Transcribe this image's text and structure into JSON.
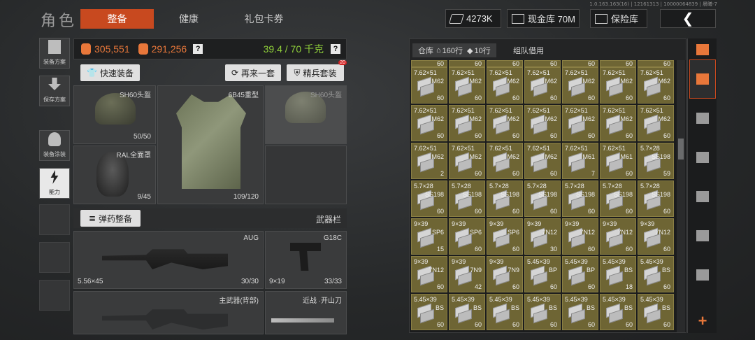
{
  "header": {
    "title": "角色",
    "tabs": [
      {
        "label": "整备",
        "active": true
      },
      {
        "label": "健康",
        "active": false
      },
      {
        "label": "礼包卡券",
        "active": false
      }
    ],
    "version": "1.0.163.163(16) | 12161313 | 10000064839 | 晨曦-7",
    "currency": "4273K",
    "cash_vault": "现金库 70M",
    "safe": "保险库"
  },
  "sidebar": [
    {
      "label": "装备方案"
    },
    {
      "label": "保存方案"
    },
    {
      "label": "装备涂装"
    },
    {
      "label": "能力"
    }
  ],
  "stats": {
    "value1": "305,551",
    "value2": "291,256",
    "weight": "39.4 / 70 千克"
  },
  "actions": {
    "quick_equip": "快速装备",
    "again": "再来一套",
    "elite": "精兵套装",
    "elite_badge": "20"
  },
  "gear": {
    "helmet": {
      "name": "SH60头盔",
      "durability": "50/50"
    },
    "armor": {
      "name": "6B45重型",
      "durability": "109/120"
    },
    "helmet_preview": {
      "name": "SH60头盔"
    },
    "mask": {
      "name": "RAL全面罩",
      "durability": "9/45"
    }
  },
  "weapons": {
    "ammo_button": "弹药整备",
    "section": "武器栏",
    "primary": {
      "name": "AUG",
      "caliber": "5.56×45",
      "ammo": "30/30"
    },
    "pistol": {
      "name": "G18C",
      "caliber": "9×19",
      "ammo": "33/33"
    },
    "backup": {
      "name": "主武器(背部)"
    },
    "melee": {
      "name": "开山刀",
      "prefix": "近战 ·"
    }
  },
  "inventory": {
    "tab_label": "仓库",
    "rows_label": "160行",
    "rows_label2": "10行",
    "tab2": "组队借用",
    "rows": [
      [
        {
          "cal": "",
          "mod": "",
          "qty": "60"
        },
        {
          "cal": "",
          "mod": "",
          "qty": "60"
        },
        {
          "cal": "",
          "mod": "",
          "qty": "60"
        },
        {
          "cal": "",
          "mod": "",
          "qty": "60"
        },
        {
          "cal": "",
          "mod": "",
          "qty": "60"
        },
        {
          "cal": "",
          "mod": "",
          "qty": "60"
        },
        {
          "cal": "",
          "mod": "",
          "qty": "60"
        }
      ],
      [
        {
          "cal": "7.62×51",
          "mod": "M62",
          "qty": "60"
        },
        {
          "cal": "7.62×51",
          "mod": "M62",
          "qty": "60"
        },
        {
          "cal": "7.62×51",
          "mod": "M62",
          "qty": "60"
        },
        {
          "cal": "7.62×51",
          "mod": "M62",
          "qty": "60"
        },
        {
          "cal": "7.62×51",
          "mod": "M62",
          "qty": "60"
        },
        {
          "cal": "7.62×51",
          "mod": "M62",
          "qty": "60"
        },
        {
          "cal": "7.62×51",
          "mod": "M62",
          "qty": "60"
        }
      ],
      [
        {
          "cal": "7.62×51",
          "mod": "M62",
          "qty": "60"
        },
        {
          "cal": "7.62×51",
          "mod": "M62",
          "qty": "60"
        },
        {
          "cal": "7.62×51",
          "mod": "M62",
          "qty": "60"
        },
        {
          "cal": "7.62×51",
          "mod": "M62",
          "qty": "60"
        },
        {
          "cal": "7.62×51",
          "mod": "M62",
          "qty": "60"
        },
        {
          "cal": "7.62×51",
          "mod": "M62",
          "qty": "60"
        },
        {
          "cal": "7.62×51",
          "mod": "M62",
          "qty": "60"
        }
      ],
      [
        {
          "cal": "7.62×51",
          "mod": "M62",
          "qty": "2"
        },
        {
          "cal": "7.62×51",
          "mod": "M62",
          "qty": "60"
        },
        {
          "cal": "7.62×51",
          "mod": "M62",
          "qty": "60"
        },
        {
          "cal": "7.62×51",
          "mod": "M62",
          "qty": "60"
        },
        {
          "cal": "7.62×51",
          "mod": "M61",
          "qty": "7"
        },
        {
          "cal": "7.62×51",
          "mod": "M61",
          "qty": "60"
        },
        {
          "cal": "5.7×28",
          "mod": "SS198",
          "qty": "59"
        }
      ],
      [
        {
          "cal": "5.7×28",
          "mod": "SS198",
          "qty": "60"
        },
        {
          "cal": "5.7×28",
          "mod": "SS198",
          "qty": "60"
        },
        {
          "cal": "5.7×28",
          "mod": "SS198",
          "qty": "60"
        },
        {
          "cal": "5.7×28",
          "mod": "SS198",
          "qty": "60"
        },
        {
          "cal": "5.7×28",
          "mod": "SS198",
          "qty": "60"
        },
        {
          "cal": "5.7×28",
          "mod": "SS198",
          "qty": "60"
        },
        {
          "cal": "5.7×28",
          "mod": "SS198",
          "qty": "60"
        }
      ],
      [
        {
          "cal": "9×39",
          "mod": "SP6",
          "qty": "15"
        },
        {
          "cal": "9×39",
          "mod": "SP6",
          "qty": "60"
        },
        {
          "cal": "9×39",
          "mod": "SP6",
          "qty": "60"
        },
        {
          "cal": "9×39",
          "mod": "7N12",
          "qty": "30"
        },
        {
          "cal": "9×39",
          "mod": "7N12",
          "qty": "60"
        },
        {
          "cal": "9×39",
          "mod": "7N12",
          "qty": "60"
        },
        {
          "cal": "9×39",
          "mod": "7N12",
          "qty": "60"
        }
      ],
      [
        {
          "cal": "9×39",
          "mod": "7N12",
          "qty": "60"
        },
        {
          "cal": "9×39",
          "mod": "7N9",
          "qty": "42"
        },
        {
          "cal": "9×39",
          "mod": "7N9",
          "qty": "60"
        },
        {
          "cal": "5.45×39",
          "mod": "BP",
          "qty": "60"
        },
        {
          "cal": "5.45×39",
          "mod": "BP",
          "qty": "60"
        },
        {
          "cal": "5.45×39",
          "mod": "BS",
          "qty": "18"
        },
        {
          "cal": "5.45×39",
          "mod": "BS",
          "qty": "60"
        }
      ],
      [
        {
          "cal": "5.45×39",
          "mod": "BS",
          "qty": "60"
        },
        {
          "cal": "5.45×39",
          "mod": "BS",
          "qty": "60"
        },
        {
          "cal": "5.45×39",
          "mod": "BS",
          "qty": "60"
        },
        {
          "cal": "5.45×39",
          "mod": "BS",
          "qty": "60"
        },
        {
          "cal": "5.45×39",
          "mod": "BS",
          "qty": "60"
        },
        {
          "cal": "5.45×39",
          "mod": "BS",
          "qty": "60"
        },
        {
          "cal": "5.45×39",
          "mod": "BS",
          "qty": "60"
        }
      ]
    ]
  },
  "rail": [
    {
      "icon": "stack-icon"
    },
    {
      "icon": "layers-icon"
    },
    {
      "icon": "vest-icon"
    },
    {
      "icon": "rifle-icon"
    },
    {
      "icon": "magazine-icon"
    },
    {
      "icon": "bullet-icon"
    },
    {
      "icon": "helmet-icon"
    },
    {
      "icon": "plus-icon"
    }
  ],
  "colors": {
    "accent": "#c8491f",
    "cell": "#6e6534",
    "green": "#8fcf3a",
    "orange": "#e8773a"
  }
}
